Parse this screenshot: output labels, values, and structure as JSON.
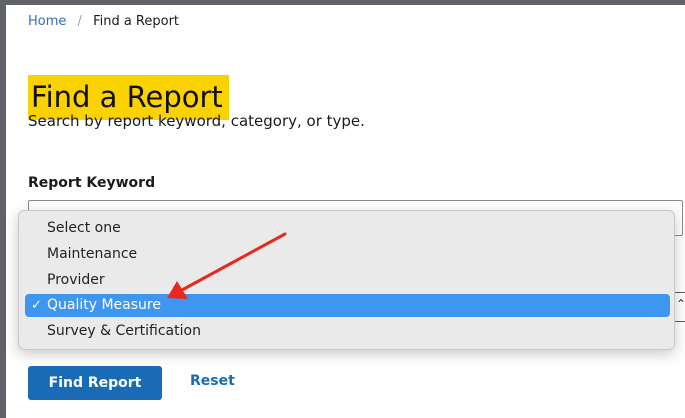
{
  "breadcrumb": {
    "home": "Home",
    "separator": "/",
    "current": "Find a Report"
  },
  "page": {
    "title": "Find a Report",
    "subtitle": "Search by report keyword, category, or type."
  },
  "keyword_field": {
    "label": "Report Keyword",
    "value": ""
  },
  "select": {
    "options": [
      "Select one",
      "Maintenance",
      "Provider",
      "Quality Measure",
      "Survey & Certification"
    ],
    "selected": "Quality Measure",
    "check_glyph": "✓"
  },
  "buttons": {
    "find_report": "Find Report",
    "reset": "Reset"
  },
  "colors": {
    "title_highlight": "#fad200",
    "primary": "#1a6bb5",
    "link": "#2e6fba",
    "selected_option": "#3f96f1",
    "annotation_arrow": "#e8281e"
  },
  "annotation": {
    "type": "red-arrow",
    "points_to": "Quality Measure"
  }
}
